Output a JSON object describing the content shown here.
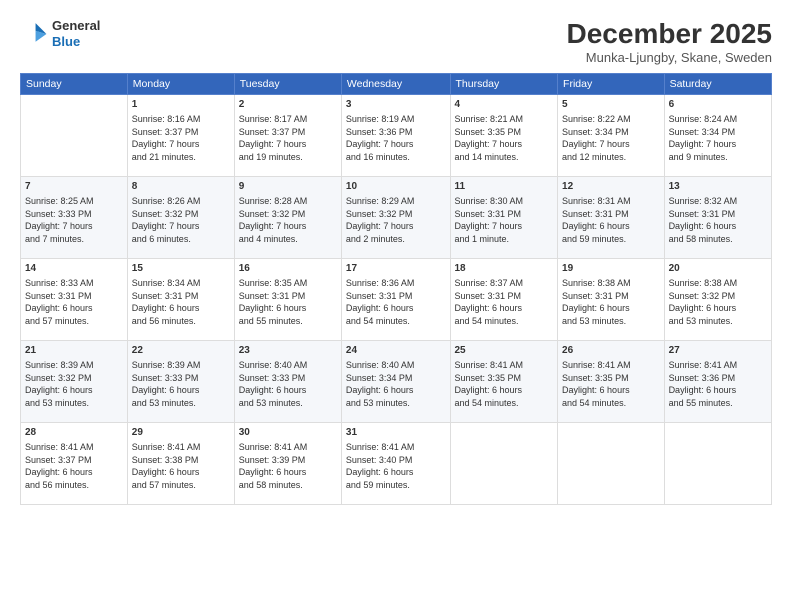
{
  "logo": {
    "general": "General",
    "blue": "Blue"
  },
  "header": {
    "month": "December 2025",
    "location": "Munka-Ljungby, Skane, Sweden"
  },
  "days_of_week": [
    "Sunday",
    "Monday",
    "Tuesday",
    "Wednesday",
    "Thursday",
    "Friday",
    "Saturday"
  ],
  "weeks": [
    [
      {
        "day": "",
        "info": ""
      },
      {
        "day": "1",
        "info": "Sunrise: 8:16 AM\nSunset: 3:37 PM\nDaylight: 7 hours\nand 21 minutes."
      },
      {
        "day": "2",
        "info": "Sunrise: 8:17 AM\nSunset: 3:37 PM\nDaylight: 7 hours\nand 19 minutes."
      },
      {
        "day": "3",
        "info": "Sunrise: 8:19 AM\nSunset: 3:36 PM\nDaylight: 7 hours\nand 16 minutes."
      },
      {
        "day": "4",
        "info": "Sunrise: 8:21 AM\nSunset: 3:35 PM\nDaylight: 7 hours\nand 14 minutes."
      },
      {
        "day": "5",
        "info": "Sunrise: 8:22 AM\nSunset: 3:34 PM\nDaylight: 7 hours\nand 12 minutes."
      },
      {
        "day": "6",
        "info": "Sunrise: 8:24 AM\nSunset: 3:34 PM\nDaylight: 7 hours\nand 9 minutes."
      }
    ],
    [
      {
        "day": "7",
        "info": "Sunrise: 8:25 AM\nSunset: 3:33 PM\nDaylight: 7 hours\nand 7 minutes."
      },
      {
        "day": "8",
        "info": "Sunrise: 8:26 AM\nSunset: 3:32 PM\nDaylight: 7 hours\nand 6 minutes."
      },
      {
        "day": "9",
        "info": "Sunrise: 8:28 AM\nSunset: 3:32 PM\nDaylight: 7 hours\nand 4 minutes."
      },
      {
        "day": "10",
        "info": "Sunrise: 8:29 AM\nSunset: 3:32 PM\nDaylight: 7 hours\nand 2 minutes."
      },
      {
        "day": "11",
        "info": "Sunrise: 8:30 AM\nSunset: 3:31 PM\nDaylight: 7 hours\nand 1 minute."
      },
      {
        "day": "12",
        "info": "Sunrise: 8:31 AM\nSunset: 3:31 PM\nDaylight: 6 hours\nand 59 minutes."
      },
      {
        "day": "13",
        "info": "Sunrise: 8:32 AM\nSunset: 3:31 PM\nDaylight: 6 hours\nand 58 minutes."
      }
    ],
    [
      {
        "day": "14",
        "info": "Sunrise: 8:33 AM\nSunset: 3:31 PM\nDaylight: 6 hours\nand 57 minutes."
      },
      {
        "day": "15",
        "info": "Sunrise: 8:34 AM\nSunset: 3:31 PM\nDaylight: 6 hours\nand 56 minutes."
      },
      {
        "day": "16",
        "info": "Sunrise: 8:35 AM\nSunset: 3:31 PM\nDaylight: 6 hours\nand 55 minutes."
      },
      {
        "day": "17",
        "info": "Sunrise: 8:36 AM\nSunset: 3:31 PM\nDaylight: 6 hours\nand 54 minutes."
      },
      {
        "day": "18",
        "info": "Sunrise: 8:37 AM\nSunset: 3:31 PM\nDaylight: 6 hours\nand 54 minutes."
      },
      {
        "day": "19",
        "info": "Sunrise: 8:38 AM\nSunset: 3:31 PM\nDaylight: 6 hours\nand 53 minutes."
      },
      {
        "day": "20",
        "info": "Sunrise: 8:38 AM\nSunset: 3:32 PM\nDaylight: 6 hours\nand 53 minutes."
      }
    ],
    [
      {
        "day": "21",
        "info": "Sunrise: 8:39 AM\nSunset: 3:32 PM\nDaylight: 6 hours\nand 53 minutes."
      },
      {
        "day": "22",
        "info": "Sunrise: 8:39 AM\nSunset: 3:33 PM\nDaylight: 6 hours\nand 53 minutes."
      },
      {
        "day": "23",
        "info": "Sunrise: 8:40 AM\nSunset: 3:33 PM\nDaylight: 6 hours\nand 53 minutes."
      },
      {
        "day": "24",
        "info": "Sunrise: 8:40 AM\nSunset: 3:34 PM\nDaylight: 6 hours\nand 53 minutes."
      },
      {
        "day": "25",
        "info": "Sunrise: 8:41 AM\nSunset: 3:35 PM\nDaylight: 6 hours\nand 54 minutes."
      },
      {
        "day": "26",
        "info": "Sunrise: 8:41 AM\nSunset: 3:35 PM\nDaylight: 6 hours\nand 54 minutes."
      },
      {
        "day": "27",
        "info": "Sunrise: 8:41 AM\nSunset: 3:36 PM\nDaylight: 6 hours\nand 55 minutes."
      }
    ],
    [
      {
        "day": "28",
        "info": "Sunrise: 8:41 AM\nSunset: 3:37 PM\nDaylight: 6 hours\nand 56 minutes."
      },
      {
        "day": "29",
        "info": "Sunrise: 8:41 AM\nSunset: 3:38 PM\nDaylight: 6 hours\nand 57 minutes."
      },
      {
        "day": "30",
        "info": "Sunrise: 8:41 AM\nSunset: 3:39 PM\nDaylight: 6 hours\nand 58 minutes."
      },
      {
        "day": "31",
        "info": "Sunrise: 8:41 AM\nSunset: 3:40 PM\nDaylight: 6 hours\nand 59 minutes."
      },
      {
        "day": "",
        "info": ""
      },
      {
        "day": "",
        "info": ""
      },
      {
        "day": "",
        "info": ""
      }
    ]
  ]
}
